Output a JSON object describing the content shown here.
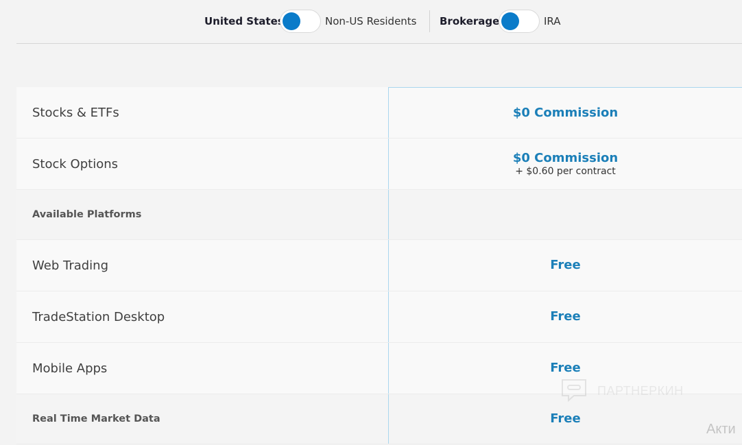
{
  "toggles": {
    "region": {
      "left_label": "United States",
      "right_label": "Non-US Residents"
    },
    "account": {
      "left_label": "Brokerage",
      "right_label": "IRA"
    }
  },
  "rows": [
    {
      "label": "Stocks & ETFs",
      "value": "$0 Commission",
      "sub": ""
    },
    {
      "label": "Stock Options",
      "value": "$0 Commission",
      "sub": "+ $0.60 per contract"
    },
    {
      "label": "Available Platforms",
      "value": "",
      "sub": ""
    },
    {
      "label": "Web Trading",
      "value": "Free",
      "sub": ""
    },
    {
      "label": "TradeStation Desktop",
      "value": "Free",
      "sub": ""
    },
    {
      "label": "Mobile Apps",
      "value": "Free",
      "sub": ""
    },
    {
      "label": "Real Time Market Data",
      "value": "Free",
      "sub": ""
    }
  ],
  "watermark": {
    "text": "ПАРТНЕРКИН"
  },
  "system_notice": {
    "text": "Акти"
  },
  "colors": {
    "accent": "#1b7fb8",
    "knob": "#0a7bc9",
    "column_border": "#a9d6ee"
  }
}
